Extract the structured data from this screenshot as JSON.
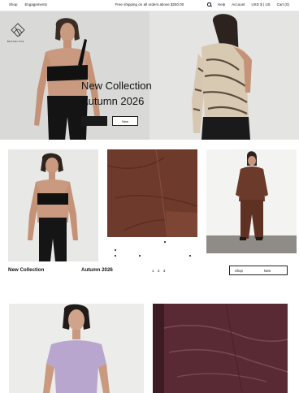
{
  "topbar": {
    "nav_left": [
      "Shop",
      "Engagements"
    ],
    "promo": "Free shipping on all orders above $250.00",
    "nav_right": {
      "help": "Help",
      "account": "Account",
      "currency": "USD $ | US",
      "cart": "Cart (0)"
    }
  },
  "hero": {
    "title_line1": "New Collection",
    "title_line2": "Autumn 2026",
    "btn_dark_label": "",
    "btn_light_label": "New",
    "logo_text": "BESSELOVE"
  },
  "section2": {
    "label_left": "New Collection",
    "label_center": "Autumn 2026",
    "pager": "1 2 3",
    "btn_shop": "Shop",
    "btn_new": "New"
  },
  "colors": {
    "accent_dark": "#1a1a1a",
    "brown_fabric": "#6e3a2b",
    "plum_fabric": "#5a2a34",
    "lilac_top": "#b9a6cf"
  }
}
